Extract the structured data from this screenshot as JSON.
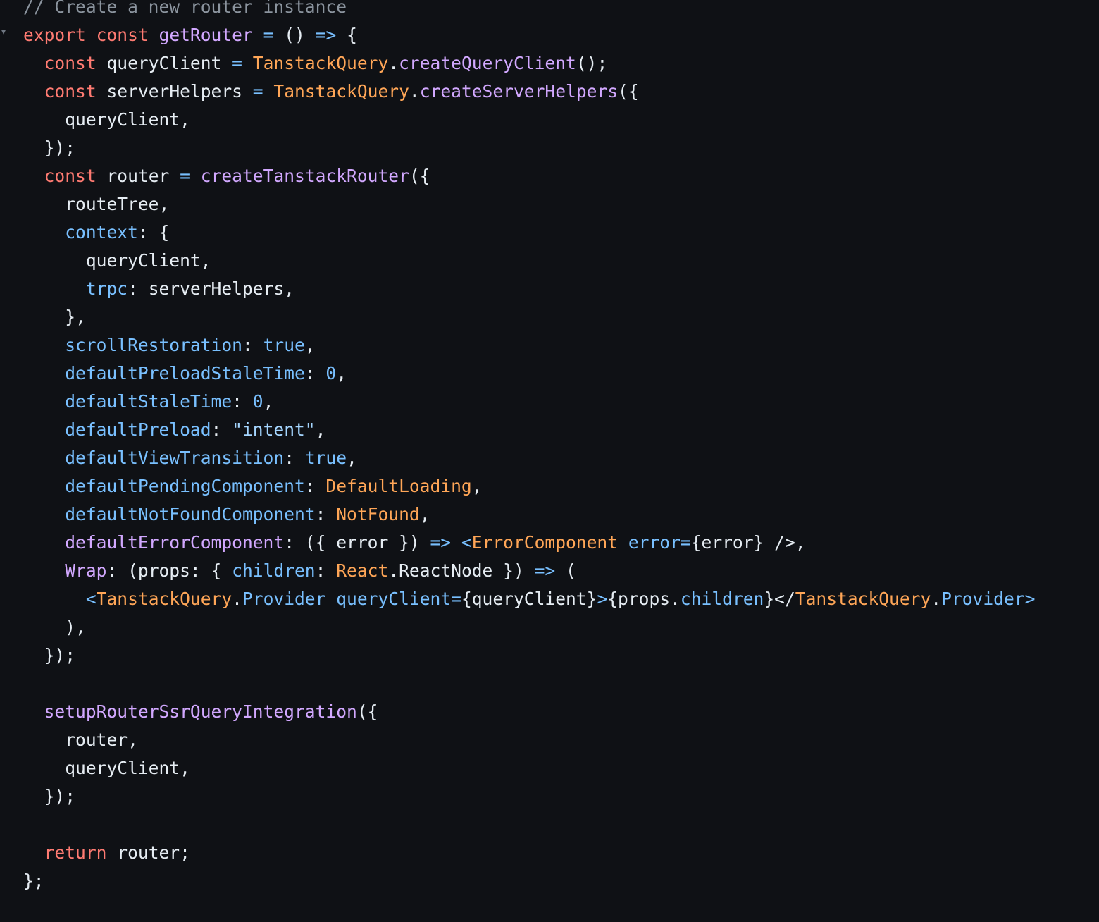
{
  "editor": {
    "theme": {
      "background": "#0f1115",
      "default": "#e6edf3",
      "comment": "#8b949e",
      "keyword": "#ff7b72",
      "function": "#d2a8ff",
      "operator": "#79c0ff",
      "class": "#ffa657",
      "property": "#79c0ff",
      "constant": "#79c0ff",
      "string": "#a5d6ff"
    },
    "fold_marker_icon": "fold-chevron-icon",
    "lines": [
      [
        [
          "comment",
          "// Create a new router instance"
        ]
      ],
      [
        [
          "keyword",
          "export"
        ],
        [
          "default",
          " "
        ],
        [
          "keyword",
          "const"
        ],
        [
          "default",
          " "
        ],
        [
          "function",
          "getRouter"
        ],
        [
          "default",
          " "
        ],
        [
          "operator",
          "="
        ],
        [
          "default",
          " () "
        ],
        [
          "operator",
          "=>"
        ],
        [
          "default",
          " {"
        ]
      ],
      [
        [
          "default",
          "  "
        ],
        [
          "keyword",
          "const"
        ],
        [
          "default",
          " queryClient "
        ],
        [
          "operator",
          "="
        ],
        [
          "default",
          " "
        ],
        [
          "class",
          "TanstackQuery"
        ],
        [
          "default",
          "."
        ],
        [
          "function",
          "createQueryClient"
        ],
        [
          "default",
          "();"
        ]
      ],
      [
        [
          "default",
          "  "
        ],
        [
          "keyword",
          "const"
        ],
        [
          "default",
          " serverHelpers "
        ],
        [
          "operator",
          "="
        ],
        [
          "default",
          " "
        ],
        [
          "class",
          "TanstackQuery"
        ],
        [
          "default",
          "."
        ],
        [
          "function",
          "createServerHelpers"
        ],
        [
          "default",
          "({"
        ]
      ],
      [
        [
          "default",
          "    queryClient,"
        ]
      ],
      [
        [
          "default",
          "  });"
        ]
      ],
      [
        [
          "default",
          "  "
        ],
        [
          "keyword",
          "const"
        ],
        [
          "default",
          " router "
        ],
        [
          "operator",
          "="
        ],
        [
          "default",
          " "
        ],
        [
          "function",
          "createTanstackRouter"
        ],
        [
          "default",
          "({"
        ]
      ],
      [
        [
          "default",
          "    routeTree,"
        ]
      ],
      [
        [
          "default",
          "    "
        ],
        [
          "property",
          "context"
        ],
        [
          "default",
          ": {"
        ]
      ],
      [
        [
          "default",
          "      queryClient,"
        ]
      ],
      [
        [
          "default",
          "      "
        ],
        [
          "property",
          "trpc"
        ],
        [
          "default",
          ": serverHelpers,"
        ]
      ],
      [
        [
          "default",
          "    },"
        ]
      ],
      [
        [
          "default",
          "    "
        ],
        [
          "property",
          "scrollRestoration"
        ],
        [
          "default",
          ": "
        ],
        [
          "constant",
          "true"
        ],
        [
          "default",
          ","
        ]
      ],
      [
        [
          "default",
          "    "
        ],
        [
          "property",
          "defaultPreloadStaleTime"
        ],
        [
          "default",
          ": "
        ],
        [
          "constant",
          "0"
        ],
        [
          "default",
          ","
        ]
      ],
      [
        [
          "default",
          "    "
        ],
        [
          "property",
          "defaultStaleTime"
        ],
        [
          "default",
          ": "
        ],
        [
          "constant",
          "0"
        ],
        [
          "default",
          ","
        ]
      ],
      [
        [
          "default",
          "    "
        ],
        [
          "property",
          "defaultPreload"
        ],
        [
          "default",
          ": "
        ],
        [
          "string",
          "\"intent\""
        ],
        [
          "default",
          ","
        ]
      ],
      [
        [
          "default",
          "    "
        ],
        [
          "property",
          "defaultViewTransition"
        ],
        [
          "default",
          ": "
        ],
        [
          "constant",
          "true"
        ],
        [
          "default",
          ","
        ]
      ],
      [
        [
          "default",
          "    "
        ],
        [
          "property",
          "defaultPendingComponent"
        ],
        [
          "default",
          ": "
        ],
        [
          "class",
          "DefaultLoading"
        ],
        [
          "default",
          ","
        ]
      ],
      [
        [
          "default",
          "    "
        ],
        [
          "property",
          "defaultNotFoundComponent"
        ],
        [
          "default",
          ": "
        ],
        [
          "class",
          "NotFound"
        ],
        [
          "default",
          ","
        ]
      ],
      [
        [
          "default",
          "    "
        ],
        [
          "function",
          "defaultErrorComponent"
        ],
        [
          "default",
          ": ({ error }) "
        ],
        [
          "operator",
          "=>"
        ],
        [
          "default",
          " "
        ],
        [
          "operator",
          "<"
        ],
        [
          "class",
          "ErrorComponent"
        ],
        [
          "default",
          " "
        ],
        [
          "attr",
          "error"
        ],
        [
          "operator",
          "="
        ],
        [
          "default",
          "{error} "
        ],
        [
          "default",
          "/>"
        ],
        [
          "default",
          ","
        ]
      ],
      [
        [
          "default",
          "    "
        ],
        [
          "function",
          "Wrap"
        ],
        [
          "default",
          ": (props: { "
        ],
        [
          "property",
          "children"
        ],
        [
          "default",
          ": "
        ],
        [
          "class",
          "React"
        ],
        [
          "default",
          ".ReactNode }) "
        ],
        [
          "operator",
          "=>"
        ],
        [
          "default",
          " ("
        ]
      ],
      [
        [
          "default",
          "      "
        ],
        [
          "operator",
          "<"
        ],
        [
          "class",
          "TanstackQuery"
        ],
        [
          "default",
          "."
        ],
        [
          "property",
          "Provider"
        ],
        [
          "default",
          " "
        ],
        [
          "attr",
          "queryClient"
        ],
        [
          "operator",
          "="
        ],
        [
          "default",
          "{queryClient}"
        ],
        [
          "operator",
          ">"
        ],
        [
          "default",
          "{props."
        ],
        [
          "property",
          "children"
        ],
        [
          "default",
          "}</"
        ],
        [
          "class",
          "TanstackQuery"
        ],
        [
          "default",
          "."
        ],
        [
          "property",
          "Provider"
        ],
        [
          "operator",
          ">"
        ]
      ],
      [
        [
          "default",
          "    ),"
        ]
      ],
      [
        [
          "default",
          "  });"
        ]
      ],
      [
        [
          "default",
          ""
        ]
      ],
      [
        [
          "default",
          "  "
        ],
        [
          "function",
          "setupRouterSsrQueryIntegration"
        ],
        [
          "default",
          "({"
        ]
      ],
      [
        [
          "default",
          "    router,"
        ]
      ],
      [
        [
          "default",
          "    queryClient,"
        ]
      ],
      [
        [
          "default",
          "  });"
        ]
      ],
      [
        [
          "default",
          ""
        ]
      ],
      [
        [
          "default",
          "  "
        ],
        [
          "keyword",
          "return"
        ],
        [
          "default",
          " router;"
        ]
      ],
      [
        [
          "default",
          "};"
        ]
      ]
    ]
  }
}
